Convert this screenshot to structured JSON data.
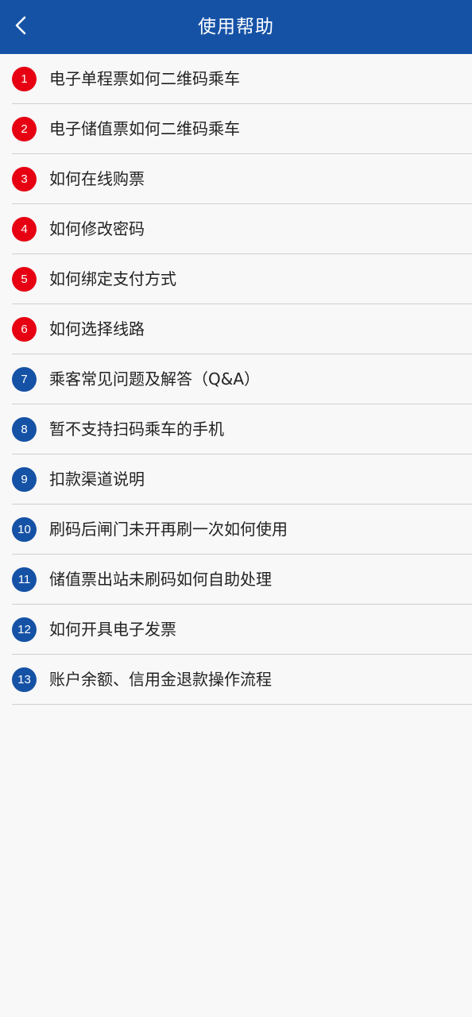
{
  "header": {
    "title": "使用帮助",
    "background": "#1552a6",
    "back_icon": "chevron-left-icon"
  },
  "colors": {
    "badge_red": "#e60012",
    "badge_blue": "#1552a6"
  },
  "help_items": [
    {
      "number": "1",
      "label": "电子单程票如何二维码乘车",
      "badge_color": "red"
    },
    {
      "number": "2",
      "label": "电子储值票如何二维码乘车",
      "badge_color": "red"
    },
    {
      "number": "3",
      "label": "如何在线购票",
      "badge_color": "red"
    },
    {
      "number": "4",
      "label": "如何修改密码",
      "badge_color": "red"
    },
    {
      "number": "5",
      "label": "如何绑定支付方式",
      "badge_color": "red"
    },
    {
      "number": "6",
      "label": "如何选择线路",
      "badge_color": "red"
    },
    {
      "number": "7",
      "label": "乘客常见问题及解答（Q&A）",
      "badge_color": "blue"
    },
    {
      "number": "8",
      "label": "暂不支持扫码乘车的手机",
      "badge_color": "blue"
    },
    {
      "number": "9",
      "label": "扣款渠道说明",
      "badge_color": "blue"
    },
    {
      "number": "10",
      "label": "刷码后闸门未开再刷一次如何使用",
      "badge_color": "blue"
    },
    {
      "number": "11",
      "label": "储值票出站未刷码如何自助处理",
      "badge_color": "blue"
    },
    {
      "number": "12",
      "label": "如何开具电子发票",
      "badge_color": "blue"
    },
    {
      "number": "13",
      "label": "账户余额、信用金退款操作流程",
      "badge_color": "blue"
    }
  ]
}
